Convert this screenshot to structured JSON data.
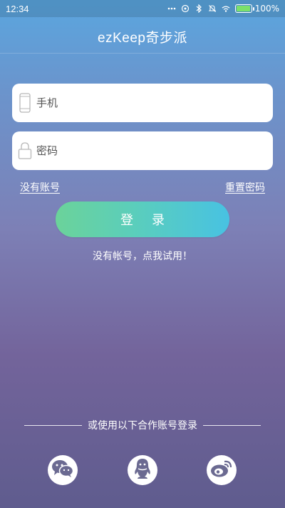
{
  "status_bar": {
    "time": "12:34",
    "battery_label": "100%",
    "battery_level": 1.0,
    "battery_color": "#7be06a",
    "icons": [
      "more-icon",
      "alarm-icon",
      "bluetooth-icon",
      "silent-icon",
      "wifi-icon",
      "battery-icon"
    ]
  },
  "header": {
    "title": "ezKeep奇步派"
  },
  "form": {
    "phone_placeholder": "手机",
    "password_placeholder": "密码",
    "no_account_link": "没有账号",
    "reset_password_link": "重置密码",
    "login_button": "登录",
    "trial_text": "没有帐号，点我试用！"
  },
  "third_party": {
    "label": "或使用以下合作账号登录",
    "providers": [
      "wechat-icon",
      "qq-icon",
      "weibo-icon"
    ]
  },
  "colors": {
    "accent_start": "#6bd39a",
    "accent_end": "#48c2e2",
    "background_top": "#5aa6df",
    "background_bottom": "#5f5c8e"
  }
}
